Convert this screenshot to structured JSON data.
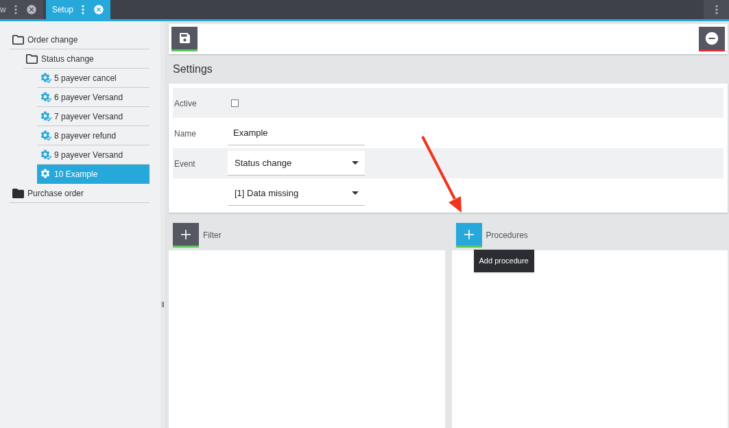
{
  "tabs": [
    {
      "label": "w",
      "selected": false
    },
    {
      "label": "Setup",
      "selected": true
    }
  ],
  "tree": [
    {
      "label": "Order change",
      "kind": "folder",
      "expanded": true,
      "selected": false,
      "children": [
        {
          "label": "Status change",
          "kind": "folder",
          "expanded": true,
          "selected": false,
          "children": [
            {
              "label": "5 payever cancel",
              "kind": "procedure",
              "active": true,
              "selected": false
            },
            {
              "label": "6 payever Versand",
              "kind": "procedure",
              "active": true,
              "selected": false
            },
            {
              "label": "7 payever Versand",
              "kind": "procedure",
              "active": true,
              "selected": false
            },
            {
              "label": "8 payever refund",
              "kind": "procedure",
              "active": true,
              "selected": false
            },
            {
              "label": "9 payever Versand",
              "kind": "procedure",
              "active": true,
              "selected": false
            },
            {
              "label": "10 Example",
              "kind": "procedure",
              "active": false,
              "selected": true
            }
          ]
        }
      ]
    },
    {
      "label": "Purchase order",
      "kind": "folder",
      "expanded": false,
      "selected": false
    }
  ],
  "toolbar": [
    {
      "kind": "save"
    },
    {
      "kind": "remove"
    }
  ],
  "settings": {
    "title": "Settings",
    "fields": [
      {
        "kind": "checkbox",
        "label": "Active",
        "checked": false
      },
      {
        "kind": "text",
        "label": "Name",
        "value": "Example"
      },
      {
        "kind": "select",
        "label": "Event",
        "value": "Status change"
      },
      {
        "kind": "select",
        "value": "[1] Data missing"
      }
    ]
  },
  "sections": [
    {
      "label": "Filter",
      "highlighted": false
    },
    {
      "label": "Procedures",
      "highlighted": true,
      "tooltip": "Add procedure"
    }
  ]
}
